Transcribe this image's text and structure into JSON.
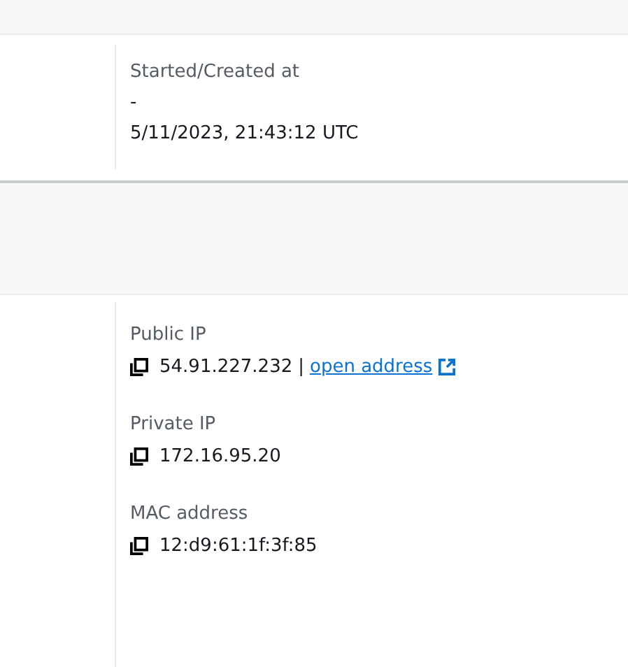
{
  "timing_card": {
    "fields": [
      {
        "label": "Started/Created at",
        "lines": [
          "-",
          "5/11/2023, 21:43:12 UTC"
        ]
      }
    ]
  },
  "network_card": {
    "fields": [
      {
        "label": "Public IP",
        "value": "54.91.227.232",
        "separator": "|",
        "link": "open address"
      },
      {
        "label": "Private IP",
        "value": "172.16.95.20"
      },
      {
        "label": "MAC address",
        "value": "12:d9:61:1f:3f:85"
      }
    ]
  }
}
